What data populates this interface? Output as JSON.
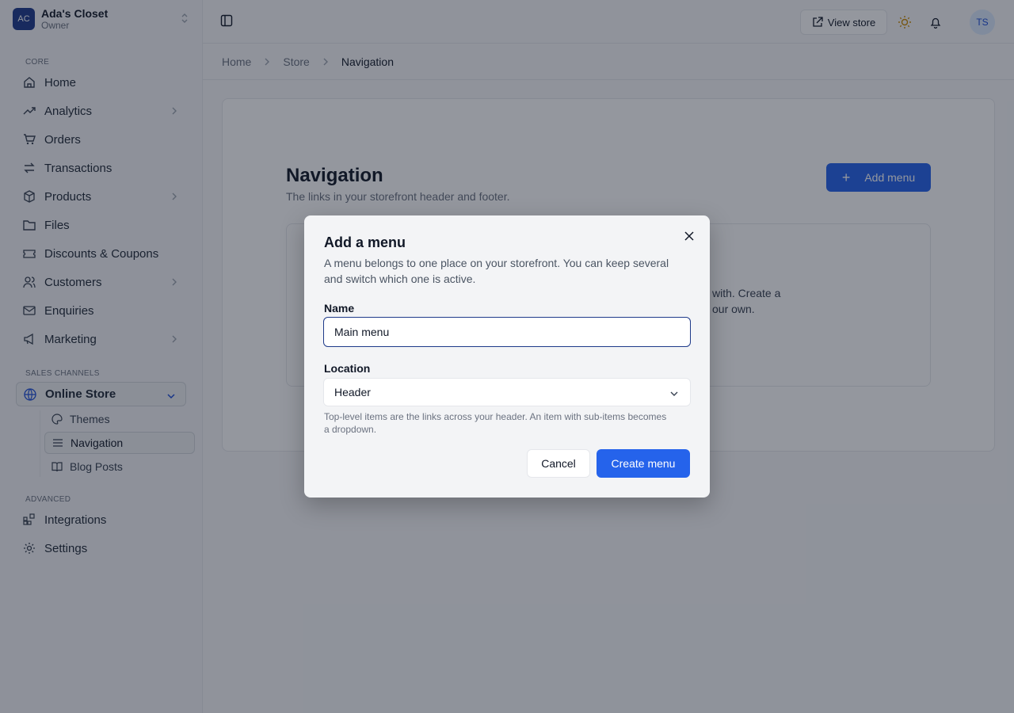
{
  "store": {
    "initials": "AC",
    "name": "Ada's Closet",
    "role": "Owner"
  },
  "sidebar": {
    "sections": {
      "core": "CORE",
      "sales": "SALES CHANNELS",
      "advanced": "ADVANCED"
    },
    "core_items": [
      {
        "label": "Home",
        "icon": "home-icon"
      },
      {
        "label": "Analytics",
        "icon": "trending-icon"
      },
      {
        "label": "Orders",
        "icon": "cart-icon"
      },
      {
        "label": "Transactions",
        "icon": "transfer-icon"
      },
      {
        "label": "Products",
        "icon": "box-icon"
      },
      {
        "label": "Files",
        "icon": "folder-icon"
      },
      {
        "label": "Discounts & Coupons",
        "icon": "ticket-icon"
      },
      {
        "label": "Customers",
        "icon": "users-icon"
      },
      {
        "label": "Enquiries",
        "icon": "mail-icon"
      },
      {
        "label": "Marketing",
        "icon": "megaphone-icon"
      }
    ],
    "online_store": {
      "label": "Online Store",
      "icon": "globe-icon"
    },
    "online_store_sub": [
      {
        "label": "Themes",
        "icon": "palette-icon"
      },
      {
        "label": "Navigation",
        "icon": "list-icon"
      },
      {
        "label": "Blog Posts",
        "icon": "book-icon"
      }
    ],
    "advanced_items": [
      {
        "label": "Integrations",
        "icon": "grid-plus-icon"
      },
      {
        "label": "Settings",
        "icon": "gear-icon"
      }
    ]
  },
  "header": {
    "view_store": "View store",
    "avatar": "TS"
  },
  "breadcrumb": [
    "Home",
    "Store",
    "Navigation"
  ],
  "page": {
    "title": "Navigation",
    "subtitle": "The links in your storefront header and footer.",
    "add_menu": "Add menu",
    "empty_text_partial": "with. Create a our own."
  },
  "modal": {
    "title": "Add a menu",
    "description": "A menu belongs to one place on your storefront. You can keep several and switch which one is active.",
    "name_label": "Name",
    "name_value": "Main menu",
    "location_label": "Location",
    "location_value": "Header",
    "help": "Top-level items are the links across your header. An item with sub-items becomes a dropdown.",
    "cancel": "Cancel",
    "create": "Create menu"
  },
  "colors": {
    "primary": "#2563eb",
    "brand": "#1e3a8a"
  }
}
